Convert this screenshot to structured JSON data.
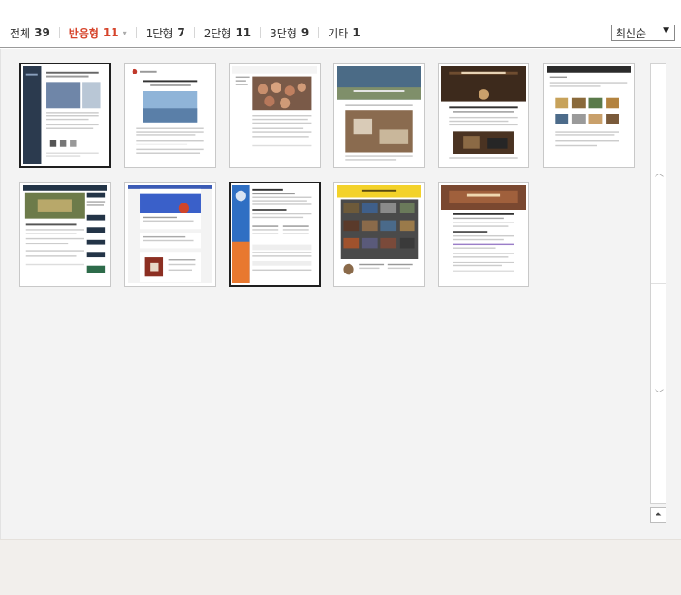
{
  "tabs": [
    {
      "label": "전체",
      "count": "39"
    },
    {
      "label": "반응형",
      "count": "11",
      "caret": "▾"
    },
    {
      "label": "1단형",
      "count": "7"
    },
    {
      "label": "2단형",
      "count": "11"
    },
    {
      "label": "3단형",
      "count": "9"
    },
    {
      "label": "기타",
      "count": "1"
    }
  ],
  "active_tab": "반응형",
  "sort": {
    "value": "최신순",
    "arrow": "▼"
  },
  "thumbnails": [
    {
      "name": "skin-thumb-1",
      "selected": true
    },
    {
      "name": "skin-thumb-2",
      "selected": false
    },
    {
      "name": "skin-thumb-3",
      "selected": false
    },
    {
      "name": "skin-thumb-4",
      "selected": false
    },
    {
      "name": "skin-thumb-5",
      "selected": false
    },
    {
      "name": "skin-thumb-6",
      "selected": false
    },
    {
      "name": "skin-thumb-7",
      "selected": false
    },
    {
      "name": "skin-thumb-8",
      "selected": false
    },
    {
      "name": "skin-thumb-9",
      "selected": true
    },
    {
      "name": "skin-thumb-10",
      "selected": false
    },
    {
      "name": "skin-thumb-11",
      "selected": false
    }
  ],
  "scrollbar": {
    "up_icon": "︿",
    "down_icon": "﹀",
    "top_icon": "⏶"
  },
  "colors": {
    "active_tab": "#d6442b",
    "panel_bg": "#f3f3f3",
    "footer_bg": "#f2efec"
  }
}
